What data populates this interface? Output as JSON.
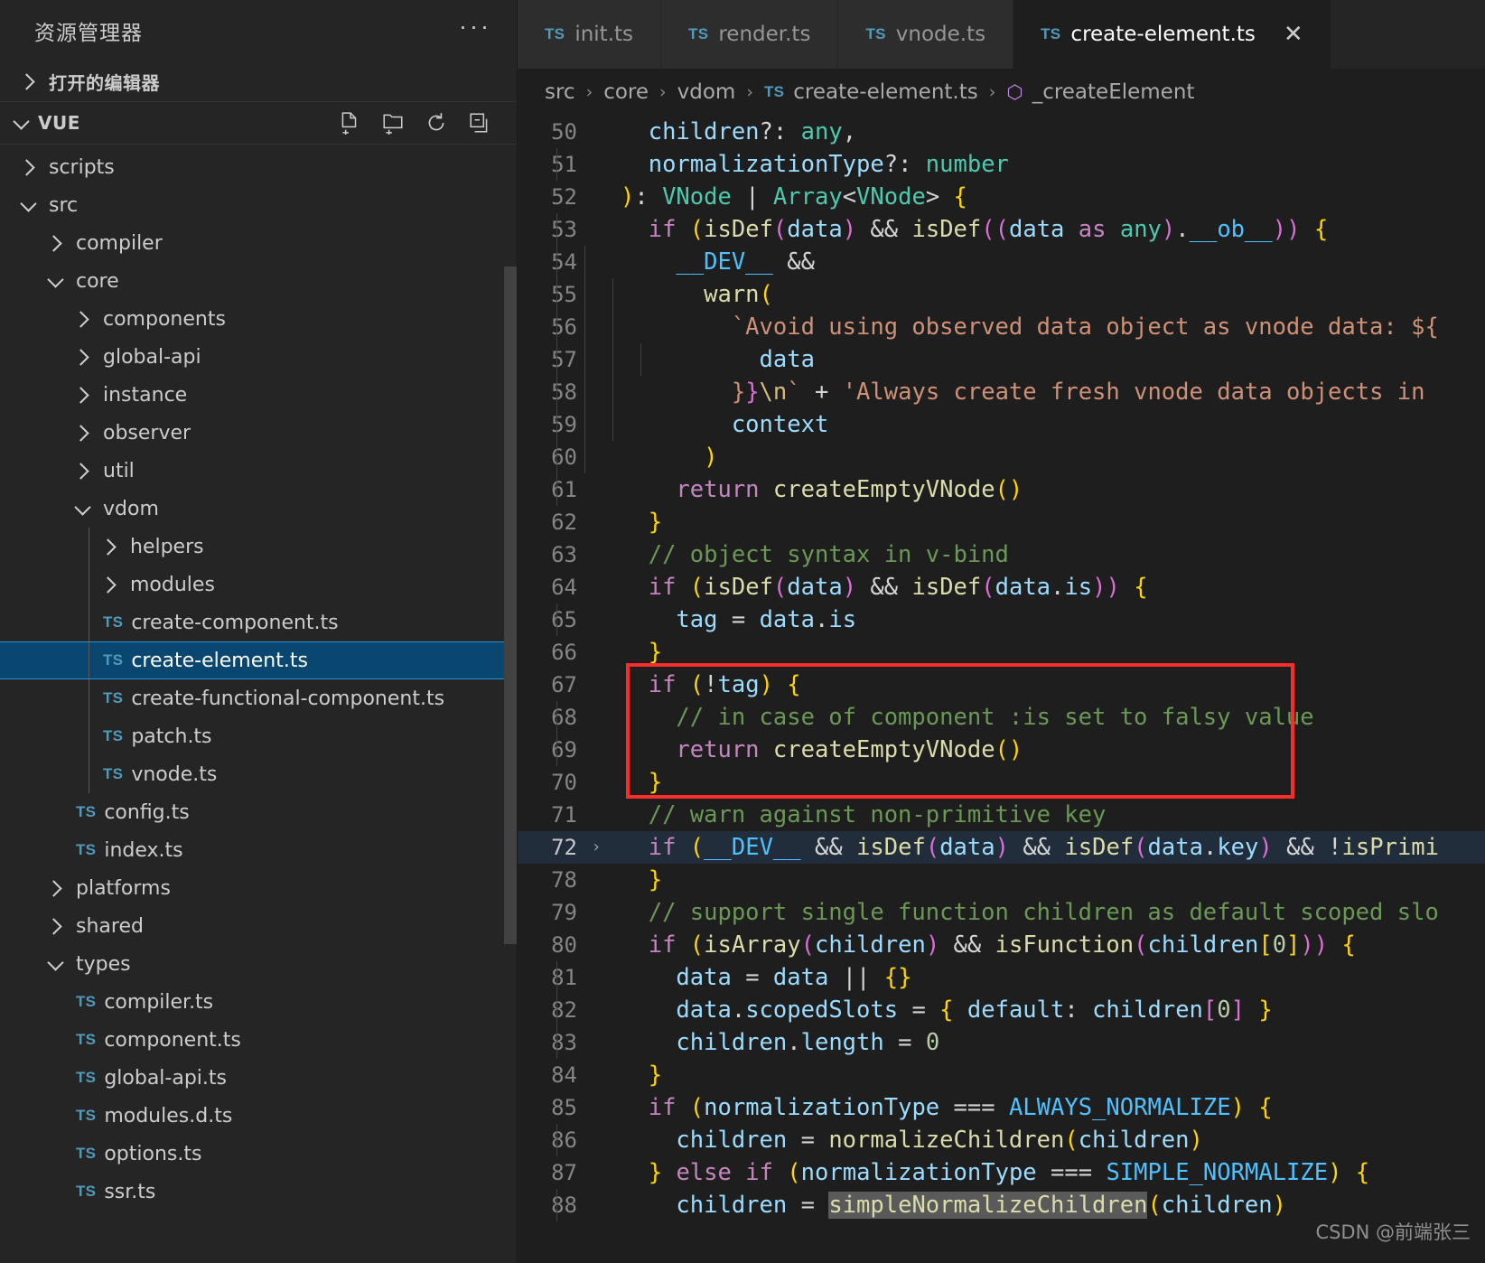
{
  "sidebar": {
    "title": "资源管理器",
    "more_label": "···",
    "open_editors_label": "打开的编辑器",
    "workspace_label": "VUE",
    "actions": [
      {
        "name": "new-file-icon",
        "label": "新建文件"
      },
      {
        "name": "new-folder-icon",
        "label": "新建文件夹"
      },
      {
        "name": "refresh-icon",
        "label": "刷新资源管理器"
      },
      {
        "name": "collapse-all-icon",
        "label": "在资源管理器中折叠文件夹"
      }
    ],
    "tree": [
      {
        "label": "scripts",
        "type": "folder",
        "open": false,
        "depth": 1,
        "selected": false
      },
      {
        "label": "src",
        "type": "folder",
        "open": true,
        "depth": 1,
        "selected": false
      },
      {
        "label": "compiler",
        "type": "folder",
        "open": false,
        "depth": 2,
        "selected": false
      },
      {
        "label": "core",
        "type": "folder",
        "open": true,
        "depth": 2,
        "selected": false
      },
      {
        "label": "components",
        "type": "folder",
        "open": false,
        "depth": 3,
        "selected": false
      },
      {
        "label": "global-api",
        "type": "folder",
        "open": false,
        "depth": 3,
        "selected": false
      },
      {
        "label": "instance",
        "type": "folder",
        "open": false,
        "depth": 3,
        "selected": false
      },
      {
        "label": "observer",
        "type": "folder",
        "open": false,
        "depth": 3,
        "selected": false
      },
      {
        "label": "util",
        "type": "folder",
        "open": false,
        "depth": 3,
        "selected": false
      },
      {
        "label": "vdom",
        "type": "folder",
        "open": true,
        "depth": 3,
        "selected": false
      },
      {
        "label": "helpers",
        "type": "folder",
        "open": false,
        "depth": 4,
        "selected": false
      },
      {
        "label": "modules",
        "type": "folder",
        "open": false,
        "depth": 4,
        "selected": false
      },
      {
        "label": "create-component.ts",
        "type": "ts",
        "depth": 4,
        "selected": false
      },
      {
        "label": "create-element.ts",
        "type": "ts",
        "depth": 4,
        "selected": true
      },
      {
        "label": "create-functional-component.ts",
        "type": "ts",
        "depth": 4,
        "selected": false
      },
      {
        "label": "patch.ts",
        "type": "ts",
        "depth": 4,
        "selected": false
      },
      {
        "label": "vnode.ts",
        "type": "ts",
        "depth": 4,
        "selected": false
      },
      {
        "label": "config.ts",
        "type": "ts",
        "depth": 3,
        "selected": false
      },
      {
        "label": "index.ts",
        "type": "ts",
        "depth": 3,
        "selected": false
      },
      {
        "label": "platforms",
        "type": "folder",
        "open": false,
        "depth": 2,
        "selected": false
      },
      {
        "label": "shared",
        "type": "folder",
        "open": false,
        "depth": 2,
        "selected": false
      },
      {
        "label": "types",
        "type": "folder",
        "open": true,
        "depth": 2,
        "selected": false
      },
      {
        "label": "compiler.ts",
        "type": "ts",
        "depth": 3,
        "selected": false
      },
      {
        "label": "component.ts",
        "type": "ts",
        "depth": 3,
        "selected": false
      },
      {
        "label": "global-api.ts",
        "type": "ts",
        "depth": 3,
        "selected": false
      },
      {
        "label": "modules.d.ts",
        "type": "ts",
        "depth": 3,
        "selected": false
      },
      {
        "label": "options.ts",
        "type": "ts",
        "depth": 3,
        "selected": false
      },
      {
        "label": "ssr.ts",
        "type": "ts",
        "depth": 3,
        "selected": false
      }
    ]
  },
  "tabs": [
    {
      "label": "init.ts",
      "icon": "TS",
      "active": false,
      "closable": false
    },
    {
      "label": "render.ts",
      "icon": "TS",
      "active": false,
      "closable": false
    },
    {
      "label": "vnode.ts",
      "icon": "TS",
      "active": false,
      "closable": false
    },
    {
      "label": "create-element.ts",
      "icon": "TS",
      "active": true,
      "closable": true,
      "close_label": "✕"
    }
  ],
  "breadcrumb": {
    "items": [
      "src",
      "core",
      "vdom"
    ],
    "file": "create-element.ts",
    "file_icon": "TS",
    "symbol": "_createElement",
    "symbol_icon": "function-symbol-icon",
    "separator": "›"
  },
  "code": {
    "first_line": 50,
    "lines": [
      {
        "n": 50,
        "indents": [],
        "fold": "",
        "html": "  <span class='var'>children</span><span class='pl'>?:</span> <span class='typ'>any</span><span class='pl'>,</span>"
      },
      {
        "n": 51,
        "indents": [
          1
        ],
        "fold": "",
        "html": "  <span class='var'>normalizationType</span><span class='pl'>?:</span> <span class='typ'>number</span>"
      },
      {
        "n": 52,
        "indents": [],
        "fold": "",
        "html": "<span class='pu'>)</span><span class='pl'>:</span> <span class='typ'>VNode</span> <span class='pl'>|</span> <span class='typ'>Array</span><span class='pl'>&lt;</span><span class='typ'>VNode</span><span class='pl'>&gt;</span> <span class='pu'>{</span>"
      },
      {
        "n": 53,
        "indents": [
          1
        ],
        "fold": "",
        "html": "  <span class='kw'>if</span> <span class='pu'>(</span><span class='fn'>isDef</span><span class='pu2'>(</span><span class='var'>data</span><span class='pu2'>)</span> <span class='pl'>&amp;&amp;</span> <span class='fn'>isDef</span><span class='pu2'>((</span><span class='var'>data</span> <span class='kw'>as</span> <span class='typ'>any</span><span class='pu2'>)</span><span class='pl'>.</span><span class='cls'>__ob__</span><span class='pu2'>))</span> <span class='pu'>{</span>"
      },
      {
        "n": 54,
        "indents": [
          1,
          2
        ],
        "fold": "",
        "html": "    <span class='cls'>__DEV__</span> <span class='pl'>&amp;&amp;</span>"
      },
      {
        "n": 55,
        "indents": [
          1,
          2,
          3
        ],
        "fold": "",
        "html": "      <span class='fn'>warn</span><span class='pu'>(</span>"
      },
      {
        "n": 56,
        "indents": [
          1,
          2,
          3
        ],
        "fold": "",
        "html": "        <span class='str'>`Avoid using observed data object as vnode data: $&#123;</span>"
      },
      {
        "n": 57,
        "indents": [
          1,
          2,
          3,
          4
        ],
        "fold": "",
        "html": "          <span class='var'>data</span>"
      },
      {
        "n": 58,
        "indents": [
          1,
          2,
          3
        ],
        "fold": "",
        "html": "        <span class='str'>&#125;</span><span class='pu2'>}</span><span class='esc'>\\n</span><span class='str'>`</span> <span class='pl'>+</span> <span class='str'>'Always create fresh vnode data objects in</span>"
      },
      {
        "n": 59,
        "indents": [
          1,
          2,
          3
        ],
        "fold": "",
        "html": "        <span class='var'>context</span>"
      },
      {
        "n": 60,
        "indents": [
          1,
          2
        ],
        "fold": "",
        "html": "      <span class='pu'>)</span>"
      },
      {
        "n": 61,
        "indents": [
          1
        ],
        "fold": "",
        "html": "    <span class='kw'>return</span> <span class='fn'>createEmptyVNode</span><span class='pu'>()</span>"
      },
      {
        "n": 62,
        "indents": [],
        "fold": "",
        "html": "  <span class='pu'>}</span>"
      },
      {
        "n": 63,
        "indents": [],
        "fold": "",
        "html": "  <span class='cmt'>// object syntax in v-bind</span>"
      },
      {
        "n": 64,
        "indents": [],
        "fold": "",
        "html": "  <span class='kw'>if</span> <span class='pu'>(</span><span class='fn'>isDef</span><span class='pu2'>(</span><span class='var'>data</span><span class='pu2'>)</span> <span class='pl'>&amp;&amp;</span> <span class='fn'>isDef</span><span class='pu2'>(</span><span class='var'>data</span><span class='pl'>.</span><span class='var'>is</span><span class='pu2'>))</span> <span class='pu'>{</span>"
      },
      {
        "n": 65,
        "indents": [
          1
        ],
        "fold": "",
        "html": "    <span class='var'>tag</span> <span class='pl'>=</span> <span class='var'>data</span><span class='pl'>.</span><span class='var'>is</span>"
      },
      {
        "n": 66,
        "indents": [],
        "fold": "",
        "html": "  <span class='pu'>}</span>"
      },
      {
        "n": 67,
        "indents": [],
        "fold": "",
        "html": "  <span class='kw'>if</span> <span class='pu'>(</span><span class='pl'>!</span><span class='var'>tag</span><span class='pu'>)</span> <span class='pu'>{</span>"
      },
      {
        "n": 68,
        "indents": [
          1
        ],
        "fold": "",
        "html": "    <span class='cmt'>// in case of component :is set to falsy value</span>"
      },
      {
        "n": 69,
        "indents": [
          1
        ],
        "fold": "",
        "html": "    <span class='kw'>return</span> <span class='fn'>createEmptyVNode</span><span class='pu'>()</span>"
      },
      {
        "n": 70,
        "indents": [],
        "fold": "",
        "html": "  <span class='pu'>}</span>"
      },
      {
        "n": 71,
        "indents": [],
        "fold": "",
        "html": "  <span class='cmt'>// warn against non-primitive key</span>"
      },
      {
        "n": 72,
        "indents": [],
        "fold": "›",
        "hl": true,
        "html": "  <span class='kw'>if</span> <span class='pu'>(</span><span class='cls'>__DEV__</span> <span class='pl'>&amp;&amp;</span> <span class='fn'>isDef</span><span class='pu2'>(</span><span class='var'>data</span><span class='pu2'>)</span> <span class='pl'>&amp;&amp;</span> <span class='fn'>isDef</span><span class='pu2'>(</span><span class='var'>data</span><span class='pl'>.</span><span class='var'>key</span><span class='pu2'>)</span> <span class='pl'>&amp;&amp;</span> <span class='pl'>!</span><span class='fn'>isPrimi</span>"
      },
      {
        "n": 78,
        "indents": [],
        "fold": "",
        "html": "  <span class='pu'>}</span>"
      },
      {
        "n": 79,
        "indents": [],
        "fold": "",
        "html": "  <span class='cmt'>// support single function children as default scoped slo</span>"
      },
      {
        "n": 80,
        "indents": [],
        "fold": "",
        "html": "  <span class='kw'>if</span> <span class='pu'>(</span><span class='fn'>isArray</span><span class='pu2'>(</span><span class='var'>children</span><span class='pu2'>)</span> <span class='pl'>&amp;&amp;</span> <span class='fn'>isFunction</span><span class='pu2'>(</span><span class='var'>children</span><span class='pu'>[</span><span class='num'>0</span><span class='pu'>]</span><span class='pu2'>))</span> <span class='pu'>{</span>"
      },
      {
        "n": 81,
        "indents": [
          1
        ],
        "fold": "",
        "html": "    <span class='var'>data</span> <span class='pl'>=</span> <span class='var'>data</span> <span class='pl'>||</span> <span class='pu'>{}</span>"
      },
      {
        "n": 82,
        "indents": [
          1
        ],
        "fold": "",
        "html": "    <span class='var'>data</span><span class='pl'>.</span><span class='var'>scopedSlots</span> <span class='pl'>=</span> <span class='pu'>{</span> <span class='var'>default</span><span class='pl'>:</span> <span class='var'>children</span><span class='pu2'>[</span><span class='num'>0</span><span class='pu2'>]</span> <span class='pu'>}</span>"
      },
      {
        "n": 83,
        "indents": [
          1
        ],
        "fold": "",
        "html": "    <span class='var'>children</span><span class='pl'>.</span><span class='var'>length</span> <span class='pl'>=</span> <span class='num'>0</span>"
      },
      {
        "n": 84,
        "indents": [],
        "fold": "",
        "html": "  <span class='pu'>}</span>"
      },
      {
        "n": 85,
        "indents": [],
        "fold": "",
        "html": "  <span class='kw'>if</span> <span class='pu'>(</span><span class='var'>normalizationType</span> <span class='pl'>===</span> <span class='cls'>ALWAYS_NORMALIZE</span><span class='pu'>)</span> <span class='pu'>{</span>"
      },
      {
        "n": 86,
        "indents": [
          1
        ],
        "fold": "",
        "html": "    <span class='var'>children</span> <span class='pl'>=</span> <span class='fn'>normalizeChildren</span><span class='pu'>(</span><span class='var'>children</span><span class='pu'>)</span>"
      },
      {
        "n": 87,
        "indents": [],
        "fold": "",
        "html": "  <span class='pu'>}</span> <span class='kw'>else</span> <span class='kw'>if</span> <span class='pu'>(</span><span class='var'>normalizationType</span> <span class='pl'>===</span> <span class='cls'>SIMPLE_NORMALIZE</span><span class='pu'>)</span> <span class='pu'>{</span>"
      },
      {
        "n": 88,
        "indents": [
          1
        ],
        "fold": "",
        "html": "    <span class='var'>children</span> <span class='pl'>=</span> <span class='fn sel'>simpleNormalizeChildren</span><span class='pu'>(</span><span class='var'>children</span><span class='pu'>)</span>"
      }
    ],
    "annotation": {
      "type": "red-rectangle",
      "color": "#fb2c2c",
      "covers_lines": [
        67,
        68,
        69,
        70
      ]
    }
  },
  "watermark": "CSDN @前端张三"
}
